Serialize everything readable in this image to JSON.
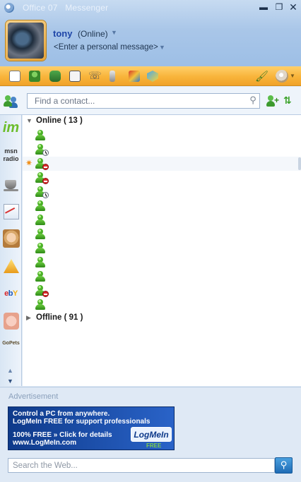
{
  "window": {
    "title": "Office 07",
    "subtitle": "Messenger",
    "minimize_glyph": "▬",
    "maximize_glyph": "❐",
    "close_glyph": "✕"
  },
  "user": {
    "name": "tony",
    "status": "(Online)",
    "personal_message": "<Enter a personal message>"
  },
  "toolbar": {
    "icons": [
      "email-icon",
      "contacts-icon",
      "games-icon",
      "calendar-icon",
      "phone-icon",
      "mobile-icon",
      "winamp-icon",
      "shield-icon"
    ],
    "brush_icon": "paintbrush-icon",
    "menu_icon": "menu-icon"
  },
  "contact_search": {
    "placeholder": "Find a contact..."
  },
  "sidebar": {
    "im_label": "im",
    "msn_label": "msn radio",
    "ebay_label": "ebY",
    "gopets_label": "GoPets"
  },
  "groups": {
    "online": {
      "label": "Online",
      "count": "( 13 )"
    },
    "offline": {
      "label": "Offline",
      "count": "( 91 )"
    }
  },
  "online_contacts": [
    {
      "status": "online"
    },
    {
      "status": "idle"
    },
    {
      "status": "busy",
      "starred": true
    },
    {
      "status": "busy"
    },
    {
      "status": "idle"
    },
    {
      "status": "online"
    },
    {
      "status": "online"
    },
    {
      "status": "online"
    },
    {
      "status": "online"
    },
    {
      "status": "online"
    },
    {
      "status": "online"
    },
    {
      "status": "busy"
    },
    {
      "status": "online"
    }
  ],
  "advertisement": {
    "label": "Advertisement",
    "line1": "Control a PC from anywhere.",
    "line2": "LogMeIn FREE for support professionals",
    "line3": "100% FREE » Click for details",
    "line4": "www.LogMeIn.com",
    "logo": "LogMeIn",
    "logo_tag": "FREE"
  },
  "web_search": {
    "placeholder": "Search the Web..."
  },
  "colors": {
    "header": "#a9c6e8",
    "toolbar": "#f8b43a",
    "accent_name": "#1f46a8",
    "ad_bg": "#0e3a8a"
  }
}
